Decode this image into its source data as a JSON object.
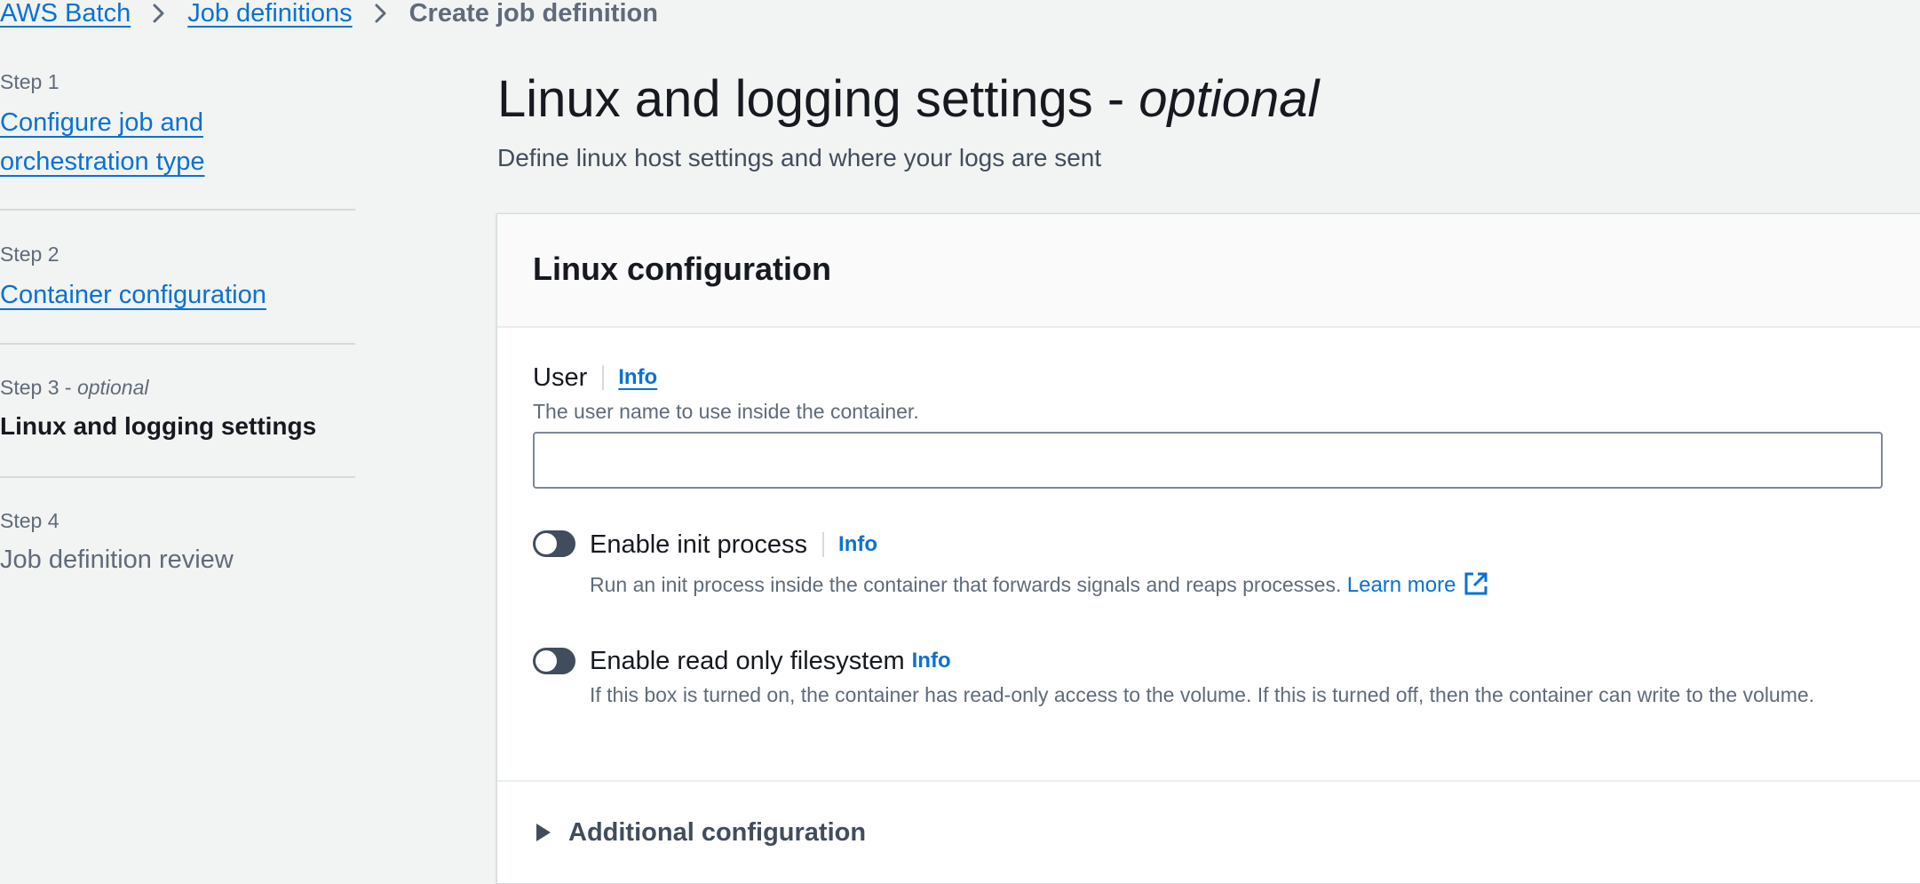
{
  "breadcrumb": {
    "items": [
      {
        "label": "AWS Batch"
      },
      {
        "label": "Job definitions"
      }
    ],
    "current": "Create job definition"
  },
  "steps": [
    {
      "number": "Step 1",
      "label": "Configure job and orchestration type"
    },
    {
      "number": "Step 2",
      "label": "Container configuration"
    },
    {
      "number": "Step 3 - ",
      "number_suffix": "optional",
      "label": "Linux and logging settings"
    },
    {
      "number": "Step 4",
      "label": "Job definition review"
    }
  ],
  "header": {
    "title": "Linux and logging settings - ",
    "title_suffix": "optional",
    "description": "Define linux host settings and where your logs are sent"
  },
  "linux_config": {
    "title": "Linux configuration",
    "user": {
      "label": "User",
      "info": "Info",
      "description": "The user name to use inside the container.",
      "value": ""
    },
    "init_process": {
      "label": "Enable init process",
      "info": "Info",
      "description": "Run an init process inside the container that forwards signals and reaps processes.",
      "learn_more": "Learn more",
      "enabled": false
    },
    "read_only": {
      "label": "Enable read only filesystem",
      "info": "Info",
      "description": "If this box is turned on, the container has read-only access to the volume. If this is turned off, then the container can write to the volume.",
      "enabled": false
    },
    "additional": {
      "label": "Additional configuration"
    }
  },
  "colors": {
    "link": "#0972d3",
    "toggle_off": "#414d5c",
    "background": "#f2f3f3"
  }
}
